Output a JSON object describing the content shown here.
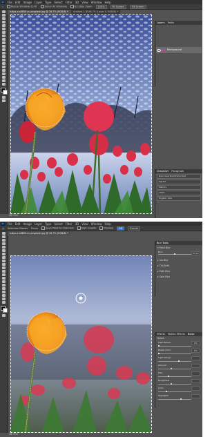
{
  "menu": {
    "app_icon": "Ps",
    "items": [
      "File",
      "Edit",
      "Image",
      "Layer",
      "Type",
      "Select",
      "Filter",
      "3D",
      "View",
      "Window",
      "Help"
    ]
  },
  "top": {
    "options": {
      "resize_label": "Resize Windows to Fit",
      "zoom_all_label": "Zoom All Windows",
      "scrubby_label": "Scrubby Zoom",
      "zoom_level": "100%",
      "fit_screen_label": "Fit Screen",
      "fill_screen_label": "Fill Screen"
    },
    "tabs": [
      "tulips-e-s8850-m-unsplash.jpg @ 26.7% (RGB/8) *",
      "Untitled-1 @ 66.7% (Layer 0, RGB/8) *"
    ],
    "status": "26.79%",
    "layers_panel": {
      "tabs": [
        "Layers",
        "Paths"
      ],
      "layer_name": "Background"
    },
    "char_panel": {
      "tabs": [
        "Character",
        "Paragraph"
      ],
      "rows": [
        "Noto Sans Bold Extra Bold",
        "Myriad",
        "Metrics",
        "100%",
        "English: USA"
      ]
    }
  },
  "bottom": {
    "options": {
      "selection_label": "Selection Bleeds",
      "focus_label": "Focus",
      "save_mask_label": "Save Mask to Channels",
      "quality_label": "High Quality",
      "preview_label": "Preview",
      "ok_label": "OK",
      "cancel_label": "Cancel"
    },
    "tabs": [
      "tulips-e-s8850-m-unsplash.jpg @ 26.7% (RGB/8) *"
    ],
    "status": "26.79%",
    "blur_tools": {
      "title": "Blur Tools",
      "items": [
        "Field Blur",
        "Iris Blur",
        "Tilt-Shift",
        "Path Blur",
        "Spin Blur"
      ],
      "blur_label": "Blur:",
      "blur_value": "15 px",
      "blur_level": 0.45
    },
    "effects_panel": {
      "tabs": [
        "Effects",
        "Motion Effects",
        "Noise"
      ],
      "sub_title": "Bokeh",
      "sliders": [
        {
          "label": "Light Bokeh:",
          "value": "0%",
          "level": 0
        },
        {
          "label": "Bokeh Color:",
          "value": "0%",
          "level": 0
        },
        {
          "label": "Light Range:",
          "value": "",
          "level": 0.8
        },
        {
          "label": "Amount",
          "value": "",
          "level": 0.5
        },
        {
          "label": "Size",
          "value": "",
          "level": 0.4
        },
        {
          "label": "Roughness",
          "value": "",
          "level": 0.5
        },
        {
          "label": "Color",
          "value": "",
          "level": 0.3
        },
        {
          "label": "Highlights",
          "value": "",
          "level": 0.9
        }
      ]
    }
  }
}
